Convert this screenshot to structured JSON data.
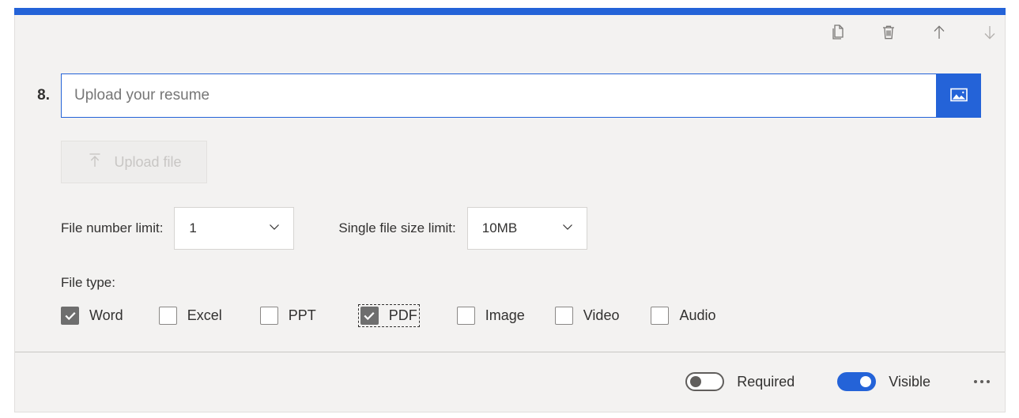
{
  "card": {
    "accent_color": "#2463d8",
    "background_color": "#f3f2f1"
  },
  "toolbar": {
    "copy_icon": "copy-icon",
    "delete_icon": "trash-icon",
    "move_up_icon": "arrow-up-icon",
    "move_down_icon": "arrow-down-icon"
  },
  "question": {
    "number": "8.",
    "title_value": "",
    "title_placeholder": "Upload your resume",
    "image_button_icon": "image-icon"
  },
  "upload": {
    "button_label": "Upload file",
    "button_icon": "upload-icon",
    "disabled": true
  },
  "limits": {
    "file_number": {
      "label": "File number limit:",
      "value": "1"
    },
    "file_size": {
      "label": "Single file size limit:",
      "value": "10MB"
    }
  },
  "file_type": {
    "label": "File type:",
    "options": [
      {
        "label": "Word",
        "checked": true,
        "focused": false
      },
      {
        "label": "Excel",
        "checked": false,
        "focused": false
      },
      {
        "label": "PPT",
        "checked": false,
        "focused": false
      },
      {
        "label": "PDF",
        "checked": true,
        "focused": true
      },
      {
        "label": "Image",
        "checked": false,
        "focused": false
      },
      {
        "label": "Video",
        "checked": false,
        "focused": false
      },
      {
        "label": "Audio",
        "checked": false,
        "focused": false
      }
    ]
  },
  "footer": {
    "required": {
      "label": "Required",
      "on": false
    },
    "visible": {
      "label": "Visible",
      "on": true
    },
    "more_icon": "more-horizontal-icon"
  }
}
